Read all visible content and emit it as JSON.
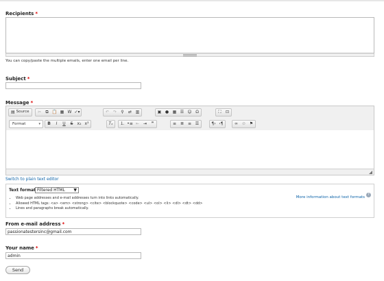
{
  "recipients": {
    "label": "Recipients",
    "required_mark": "*",
    "value": "",
    "help": "You can copy/paste the multiple emails, enter one email per line."
  },
  "subject": {
    "label": "Subject",
    "required_mark": "*",
    "value": ""
  },
  "message": {
    "label": "Message",
    "required_mark": "*",
    "toolbar": {
      "source_label": "Source",
      "format_label": "Format"
    },
    "switch_link": "Switch to plain text editor"
  },
  "text_format": {
    "label": "Text format",
    "selected": "Filtered HTML",
    "more_info_link": "More information about text formats",
    "tips": [
      "Web page addresses and e-mail addresses turn into links automatically.",
      "Allowed HTML tags: <a> <em> <strong> <cite> <blockquote> <code> <ul> <ol> <li> <dl> <dt> <dd>",
      "Lines and paragraphs break automatically."
    ]
  },
  "from_email": {
    "label": "From e-mail address",
    "required_mark": "*",
    "value": "passionatestersinc@gmail.com"
  },
  "your_name": {
    "label": "Your name",
    "required_mark": "*",
    "value": "admin"
  },
  "send_button": "Send"
}
